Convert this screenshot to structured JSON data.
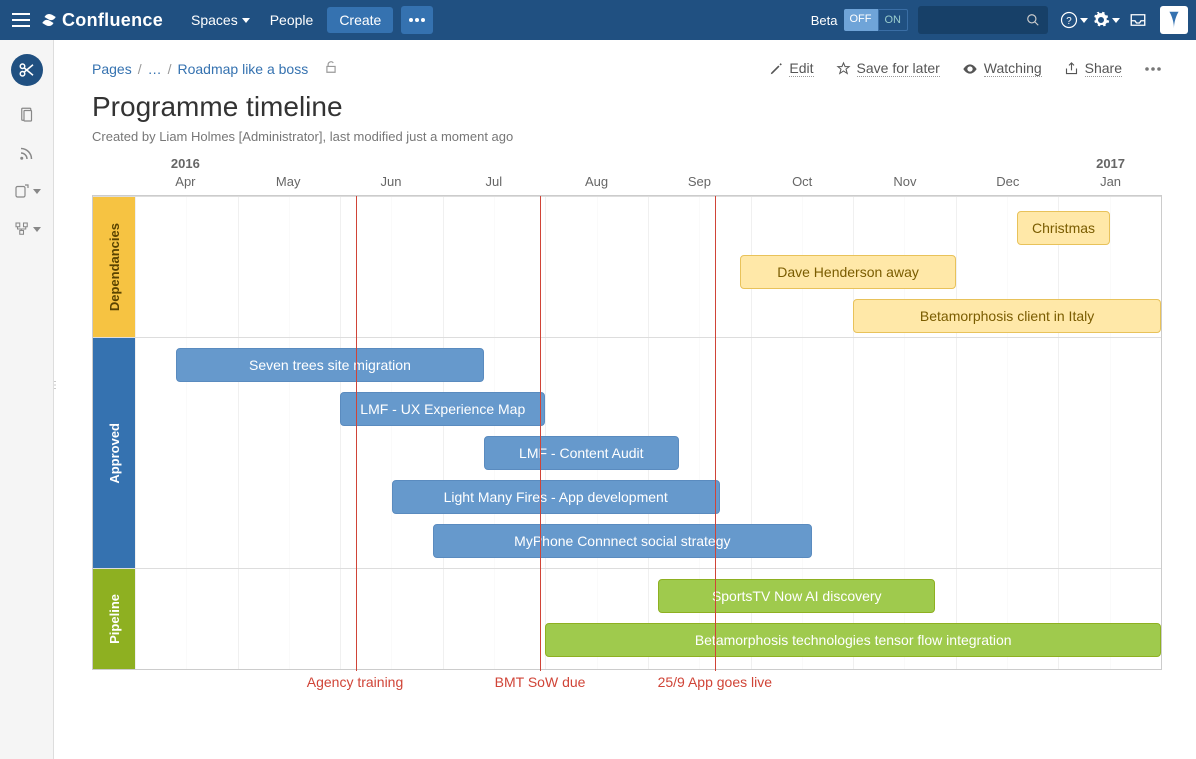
{
  "header": {
    "product": "Confluence",
    "nav": {
      "spaces": "Spaces",
      "people": "People"
    },
    "create_label": "Create",
    "beta_label": "Beta",
    "toggle_off": "OFF",
    "toggle_on": "ON"
  },
  "breadcrumb": {
    "root": "Pages",
    "ellipsis": "…",
    "current": "Roadmap like a boss"
  },
  "actions": {
    "edit": "Edit",
    "save": "Save for later",
    "watch": "Watching",
    "share": "Share"
  },
  "page": {
    "title": "Programme timeline",
    "meta": "Created by Liam Holmes [Administrator], last modified just a moment ago"
  },
  "roadmap": {
    "months": [
      "Apr",
      "May",
      "Jun",
      "Jul",
      "Aug",
      "Sep",
      "Oct",
      "Nov",
      "Dec",
      "Jan"
    ],
    "year_start": "2016",
    "year_end": "2017",
    "lanes": {
      "dependencies_label": "Dependancies",
      "approved_label": "Approved",
      "pipeline_label": "Pipeline"
    },
    "bars": {
      "dep1": "Christmas",
      "dep2": "Dave Henderson away",
      "dep3": "Betamorphosis client in Italy",
      "app1": "Seven trees site migration",
      "app2": "LMF - UX Experience Map",
      "app3": "LMF - Content Audit",
      "app4": "Light Many Fires - App development",
      "app5": "MyPhone Connnect social strategy",
      "pipe1": "SportsTV Now AI discovery",
      "pipe2": "Betamorphosis technologies tensor flow integration"
    },
    "milestones": {
      "m1": "Agency training",
      "m2": "BMT SoW due",
      "m3": "25/9 App goes live"
    }
  },
  "chart_data": {
    "type": "gantt",
    "x_axis_months": [
      "2016-04",
      "2016-05",
      "2016-06",
      "2016-07",
      "2016-08",
      "2016-09",
      "2016-10",
      "2016-11",
      "2016-12",
      "2017-01"
    ],
    "lanes": [
      {
        "name": "Dependancies",
        "color": "#f6c342",
        "bars": [
          {
            "label": "Christmas",
            "start_month": 8.6,
            "end_month": 9.5
          },
          {
            "label": "Dave Henderson away",
            "start_month": 5.9,
            "end_month": 8.0
          },
          {
            "label": "Betamorphosis client in Italy",
            "start_month": 7.0,
            "end_month": 10.0
          }
        ]
      },
      {
        "name": "Approved",
        "color": "#3572b0",
        "bars": [
          {
            "label": "Seven trees site migration",
            "start_month": 0.4,
            "end_month": 3.4
          },
          {
            "label": "LMF - UX Experience Map",
            "start_month": 2.0,
            "end_month": 4.0
          },
          {
            "label": "LMF - Content Audit",
            "start_month": 3.4,
            "end_month": 5.3
          },
          {
            "label": "Light Many Fires - App development",
            "start_month": 2.5,
            "end_month": 5.7
          },
          {
            "label": "MyPhone Connnect social strategy",
            "start_month": 2.9,
            "end_month": 6.6
          }
        ]
      },
      {
        "name": "Pipeline",
        "color": "#8eb021",
        "bars": [
          {
            "label": "SportsTV Now AI discovery",
            "start_month": 5.1,
            "end_month": 7.8
          },
          {
            "label": "Betamorphosis technologies tensor flow integration",
            "start_month": 4.0,
            "end_month": 10.0
          }
        ]
      }
    ],
    "milestones": [
      {
        "label": "Agency training",
        "month": 2.15
      },
      {
        "label": "BMT SoW due",
        "month": 3.95
      },
      {
        "label": "25/9 App goes live",
        "month": 5.65
      }
    ]
  }
}
